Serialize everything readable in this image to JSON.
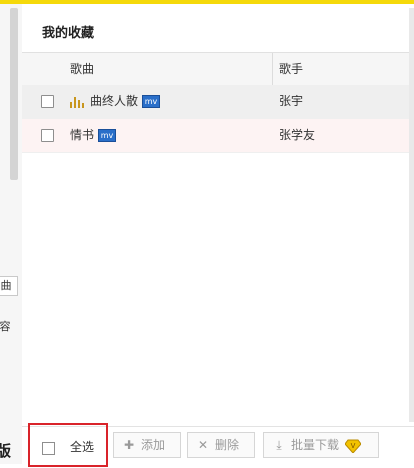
{
  "panel": {
    "title": "我的收藏"
  },
  "sidebar": {
    "tab1": "曲",
    "tab2": "容",
    "edge_label": "版"
  },
  "table": {
    "columns": {
      "song": "歌曲",
      "artist": "歌手"
    },
    "rows": [
      {
        "song": "曲终人散",
        "artist": "张宇",
        "mv": "mv",
        "playing": true
      },
      {
        "song": "情书",
        "artist": "张学友",
        "mv": "mv",
        "playing": false
      }
    ]
  },
  "footer": {
    "select_all": "全选",
    "add": "添加",
    "delete": "删除",
    "batch_download": "批量下载"
  },
  "colors": {
    "accent_yellow": "#f5d90a",
    "highlight_red": "#d9232a",
    "mv_blue": "#2a6fc9",
    "equalizer_gold": "#c8961e"
  },
  "icons": {
    "playing": "equalizer-icon",
    "mv": "mv-badge-icon",
    "add": "plus-icon",
    "delete": "x-icon",
    "download": "download-icon",
    "vip": "vip-diamond-icon"
  }
}
